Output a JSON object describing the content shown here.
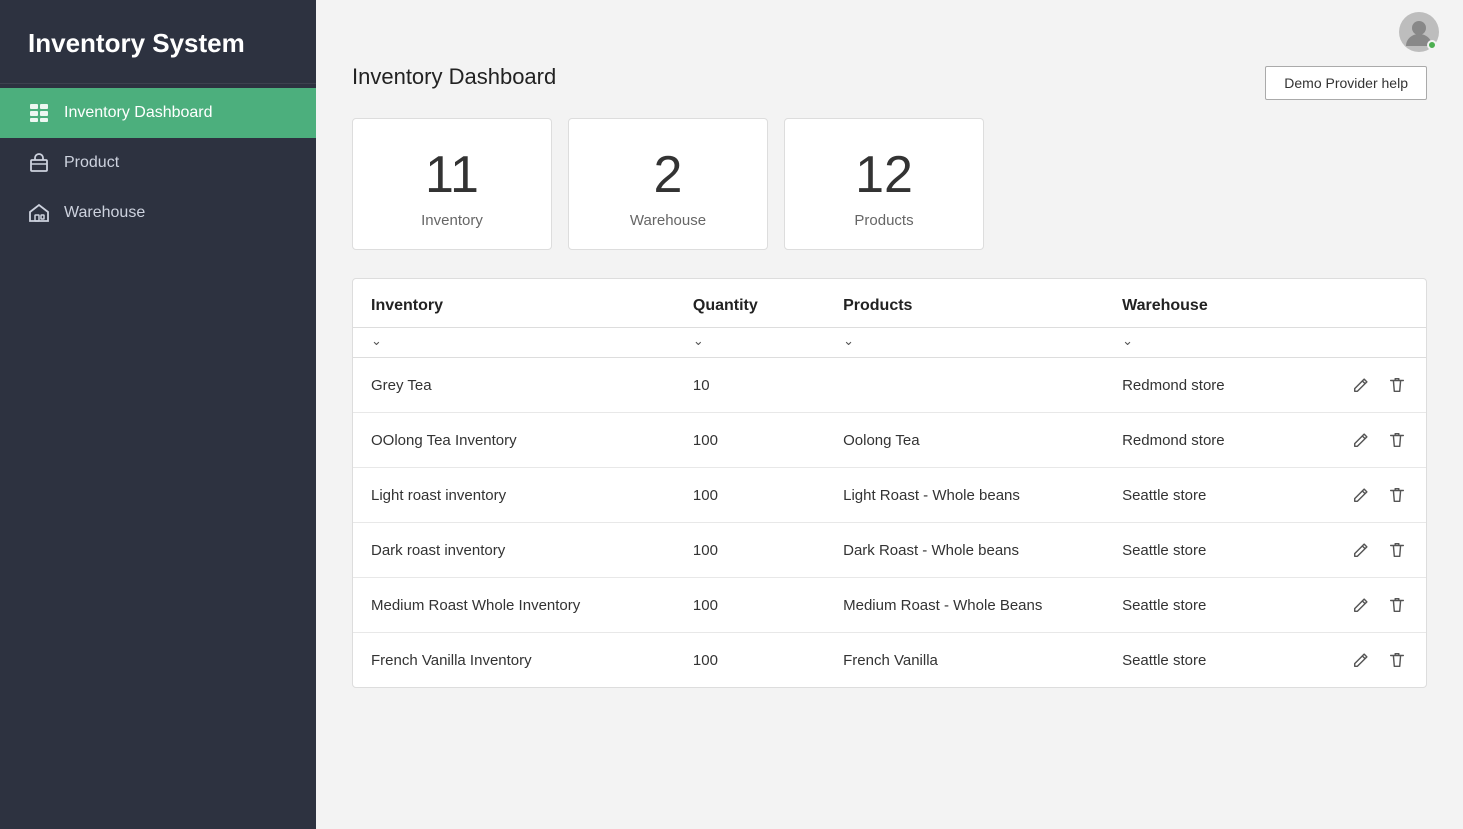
{
  "sidebar": {
    "title": "Inventory System",
    "nav": [
      {
        "id": "dashboard",
        "label": "Inventory Dashboard",
        "active": true,
        "icon": "grid-icon"
      },
      {
        "id": "product",
        "label": "Product",
        "active": false,
        "icon": "box-icon"
      },
      {
        "id": "warehouse",
        "label": "Warehouse",
        "active": false,
        "icon": "warehouse-icon"
      }
    ]
  },
  "header": {
    "help_button": "Demo Provider help"
  },
  "page": {
    "title": "Inventory Dashboard"
  },
  "stats": [
    {
      "number": "11",
      "label": "Inventory"
    },
    {
      "number": "2",
      "label": "Warehouse"
    },
    {
      "number": "12",
      "label": "Products"
    }
  ],
  "table": {
    "columns": [
      {
        "id": "inventory",
        "label": "Inventory"
      },
      {
        "id": "quantity",
        "label": "Quantity"
      },
      {
        "id": "products",
        "label": "Products"
      },
      {
        "id": "warehouse",
        "label": "Warehouse"
      }
    ],
    "rows": [
      {
        "inventory": "Grey Tea",
        "quantity": "10",
        "products": "",
        "warehouse": "Redmond store"
      },
      {
        "inventory": "OOlong Tea Inventory",
        "quantity": "100",
        "products": "Oolong Tea",
        "warehouse": "Redmond store"
      },
      {
        "inventory": "Light roast inventory",
        "quantity": "100",
        "products": "Light Roast - Whole beans",
        "warehouse": "Seattle store"
      },
      {
        "inventory": "Dark roast inventory",
        "quantity": "100",
        "products": "Dark Roast - Whole beans",
        "warehouse": "Seattle store"
      },
      {
        "inventory": "Medium Roast Whole Inventory",
        "quantity": "100",
        "products": "Medium Roast - Whole Beans",
        "warehouse": "Seattle store"
      },
      {
        "inventory": "French Vanilla Inventory",
        "quantity": "100",
        "products": "French Vanilla",
        "warehouse": "Seattle store"
      }
    ]
  },
  "icons": {
    "edit": "✏",
    "delete": "🗑",
    "chevron_down": "∨"
  }
}
